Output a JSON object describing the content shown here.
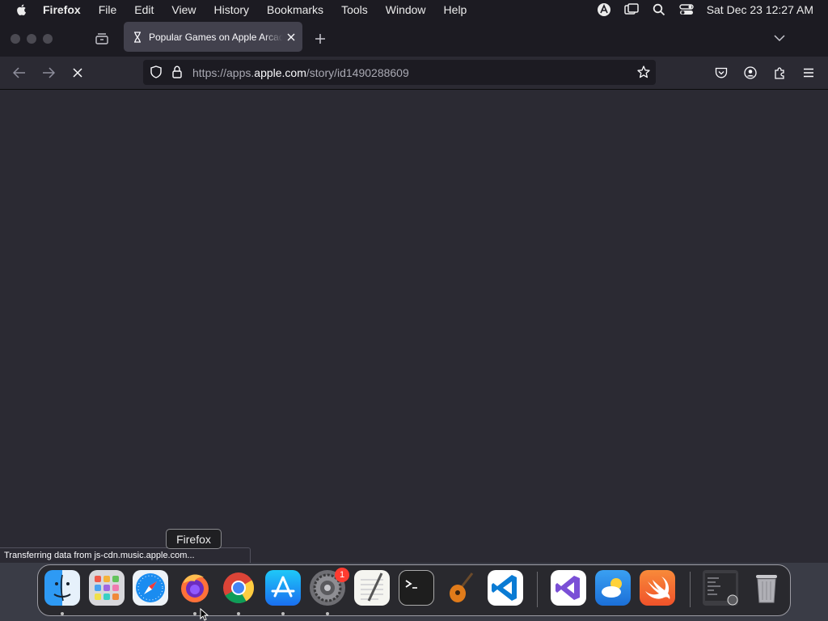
{
  "menubar": {
    "app_name": "Firefox",
    "items": [
      "File",
      "Edit",
      "View",
      "History",
      "Bookmarks",
      "Tools",
      "Window",
      "Help"
    ],
    "clock": "Sat Dec 23  12:27 AM"
  },
  "tab": {
    "title": "Popular Games on Apple Arcade"
  },
  "urlbar": {
    "url_prefix": "https://apps.",
    "url_domain": "apple.com",
    "url_suffix": "/story/id1490288609"
  },
  "status": {
    "text": "Transferring data from js-cdn.music.apple.com..."
  },
  "dock": {
    "tooltip": "Firefox",
    "badge_count": "1",
    "apps": [
      "Finder",
      "Launchpad",
      "Safari",
      "Firefox",
      "Chrome",
      "App Store",
      "System Settings",
      "TextEdit",
      "Terminal",
      "GarageBand",
      "Visual Studio Code",
      "Visual Studio",
      "Weather",
      "Swift",
      "Screenshot",
      "Trash"
    ]
  },
  "colors": {
    "chrome_bg": "#1c1b22",
    "toolbar_bg": "#2b2a33",
    "tab_selected": "#42414d",
    "text": "#fbfbfe"
  }
}
